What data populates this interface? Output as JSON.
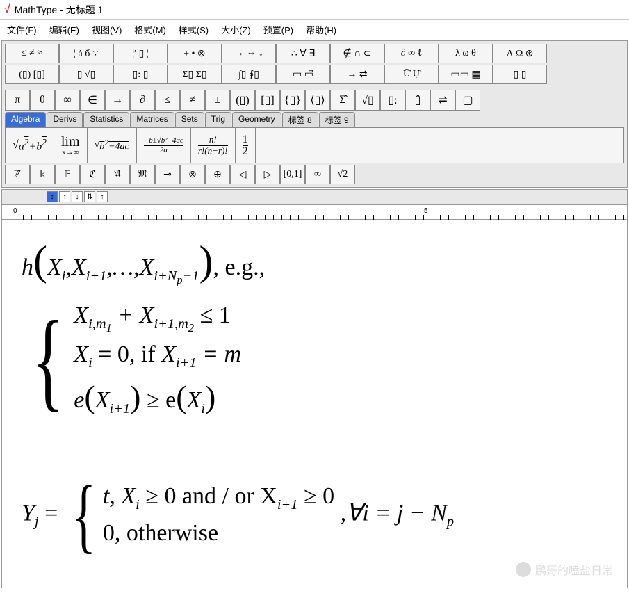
{
  "window": {
    "title": "MathType - 无标题 1"
  },
  "menu": [
    "文件(F)",
    "编辑(E)",
    "视图(V)",
    "格式(M)",
    "样式(S)",
    "大小(Z)",
    "预置(P)",
    "帮助(H)"
  ],
  "toolbar_row1": [
    "≤ ≠ ≈",
    "¦ ȧ б ∵",
    "¦′ ▯ ¦",
    "± • ⊗",
    "→ ⇔ ↓",
    "∴ ∀ ∃",
    "∉ ∩ ⊂",
    "∂ ∞ ℓ",
    "λ ω θ",
    "Λ Ω ⊛"
  ],
  "toolbar_row2": [
    "(▯) [▯]",
    "▯ √▯",
    "▯: ▯",
    "Σ▯ Σ▯",
    "∫▯ ∮▯",
    "▭ ▭⃗",
    "→ ⇄",
    "Ū̇ Ụ̂",
    "▭▭ ▦",
    "▯ ▯"
  ],
  "toolbar_row3": [
    "π",
    "θ",
    "∞",
    "∈",
    "→",
    "∂",
    "≤",
    "≠",
    "±",
    "(▯)",
    "[▯]",
    "{▯}",
    "⟨▯⟩",
    "Σ̂",
    "√▯",
    "▯:",
    "▯̂",
    "⇌",
    "▢"
  ],
  "tabs": [
    "Algebra",
    "Derivs",
    "Statistics",
    "Matrices",
    "Sets",
    "Trig",
    "Geometry",
    "标签 8",
    "标签 9"
  ],
  "templates": [
    "√(a²+b²)",
    "lim x→∞",
    "√(b²−4ac)",
    "(−b±√(b²−4ac))/2a",
    "n! / r!(n−r)!",
    "1/2"
  ],
  "toolbar_row5": [
    "ℤ",
    "𝕜",
    "𝔽",
    "ℭ",
    "𝔄",
    "𝔐",
    "⊸",
    "⊗",
    "⊕",
    "◁",
    "▷",
    "[0,1]",
    "∞",
    "√2"
  ],
  "ruler": {
    "marks": [
      "0",
      "5"
    ]
  },
  "equation": {
    "line1_a": "h",
    "line1_paren_open": "(",
    "line1_b": "X",
    "line1_bs": "i",
    "line1_c": ",X",
    "line1_cs": "i+1",
    "line1_d": ",…,X",
    "line1_ds1": "i+N",
    "line1_ds2": "p",
    "line1_ds3": "−1",
    "line1_paren_close": ")",
    "line1_e": ",  e.g.,",
    "c1_a": "X",
    "c1_as1": "i,m",
    "c1_as2": "1",
    "c1_b": " + X",
    "c1_bs1": "i+1,m",
    "c1_bs2": "2",
    "c1_c": " ≤ 1",
    "c2_a": "X",
    "c2_as": "i",
    "c2_b": " = 0,  if ",
    "c2_c": "X",
    "c2_cs": "i+1",
    "c2_d": " = m",
    "c3_a": "e",
    "c3_po": "(",
    "c3_b": "X",
    "c3_bs": "i+1",
    "c3_pc": ")",
    "c3_c": " ≥ e",
    "c3_po2": "(",
    "c3_d": "X",
    "c3_ds": "i",
    "c3_pc2": ")",
    "y_lhs_a": "Y",
    "y_lhs_as": "j",
    "y_lhs_b": " = ",
    "y1_a": "t, X",
    "y1_as": "i",
    "y1_b": " ≥ 0 and  /  or X",
    "y1_bs": "i+1",
    "y1_c": " ≥ 0",
    "y2": "0,  otherwise",
    "y_rhs_a": ",∀i = j − N",
    "y_rhs_as": "p"
  },
  "watermark": "鹏哥的嗑盐日常"
}
